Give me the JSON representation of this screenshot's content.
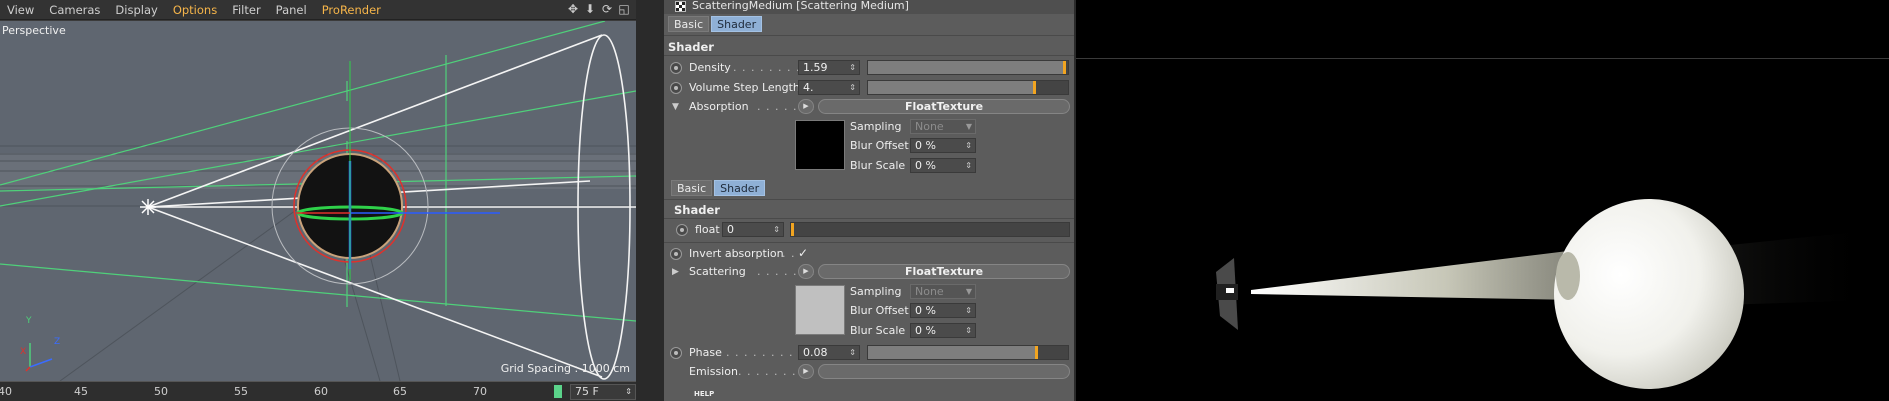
{
  "viewport": {
    "menu": [
      "View",
      "Cameras",
      "Display",
      "Options",
      "Filter",
      "Panel",
      "ProRender"
    ],
    "highlighted_menus": [
      "Options",
      "ProRender"
    ],
    "camera_label": "Perspective",
    "grid_spacing": "Grid Spacing : 1000 cm",
    "axis_labels": {
      "x": "X",
      "y": "Y",
      "z": "Z"
    },
    "nav_icons": [
      "move-view-icon",
      "zoom-view-icon",
      "rotate-view-icon",
      "maximize-view-icon"
    ]
  },
  "timeline": {
    "ticks": [
      "40",
      "45",
      "50",
      "55",
      "60",
      "65",
      "70"
    ],
    "frame_field": "75 F"
  },
  "attributes": {
    "title": "ScatteringMedium [Scattering Medium]",
    "tabs_top": [
      "Basic",
      "Shader"
    ],
    "section_shader": "Shader",
    "density": {
      "label": "Density",
      "value": "1.59",
      "slider_fraction": 0.99
    },
    "volume_step": {
      "label": "Volume Step Length",
      "value": "4.",
      "slider_fraction": 0.84
    },
    "absorption": {
      "label": "Absorption",
      "texture": "FloatTexture",
      "sampling_label": "Sampling",
      "sampling_value": "None",
      "blur_offset_label": "Blur Offset",
      "blur_offset_value": "0 %",
      "blur_scale_label": "Blur Scale",
      "blur_scale_value": "0 %",
      "preview_color": "#000000"
    },
    "tabs_inner": [
      "Basic",
      "Shader"
    ],
    "inner_section": "Shader",
    "float": {
      "label": "float",
      "value": "0",
      "slider_fraction": 0.0
    },
    "invert_absorption": {
      "label": "Invert absorption",
      "checked": "✓"
    },
    "scattering": {
      "label": "Scattering",
      "texture": "FloatTexture",
      "sampling_label": "Sampling",
      "sampling_value": "None",
      "blur_offset_label": "Blur Offset",
      "blur_offset_value": "0 %",
      "blur_scale_label": "Blur Scale",
      "blur_scale_value": "0 %",
      "preview_color": "#c0c0c0"
    },
    "phase": {
      "label": "Phase",
      "value": "0.08",
      "slider_fraction": 0.85
    },
    "emission": {
      "label": "Emission"
    },
    "help": "HELP"
  },
  "colors": {
    "accent_orange": "#f2a521",
    "menu_highlight": "#f6b54a",
    "tab_active": "#8fb0d6",
    "viewport_bg": "#5f6670",
    "guide_green": "#4fd17a"
  }
}
